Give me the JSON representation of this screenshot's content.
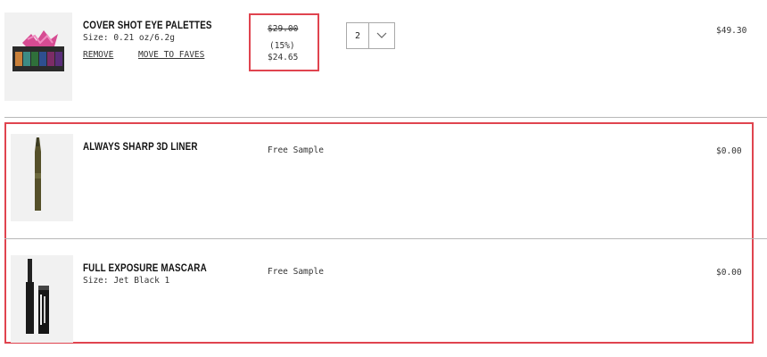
{
  "items": [
    {
      "name": "COVER SHOT EYE PALETTES",
      "size": "Size: 0.21 oz/6.2g",
      "remove_label": "REMOVE",
      "fave_label": "MOVE TO FAVES",
      "original_price": "$29.00",
      "discount": "(15%)",
      "sale_price": "$24.65",
      "quantity": "2",
      "total": "$49.30"
    },
    {
      "name": "ALWAYS SHARP 3D LINER",
      "price_note": "Free Sample",
      "total": "$0.00"
    },
    {
      "name": "FULL EXPOSURE MASCARA",
      "size": "Size: Jet Black 1",
      "price_note": "Free Sample",
      "total": "$0.00"
    }
  ],
  "icons": {
    "qty_dropdown": "chevron-down-icon"
  },
  "colors": {
    "highlight": "#e0444f"
  }
}
